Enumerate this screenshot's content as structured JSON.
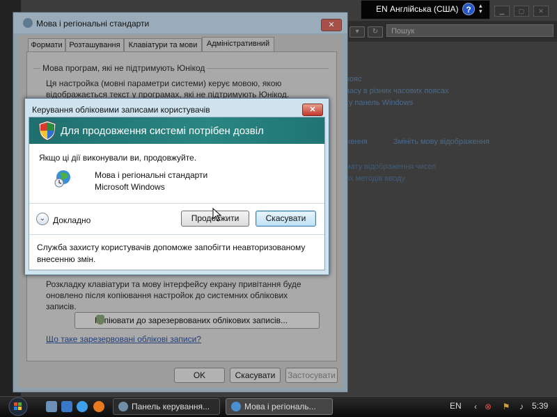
{
  "background": {
    "search_placeholder": "Пошук",
    "links": [
      "пояс",
      "часу в різних часових поясах",
      "ку панель Windows",
      "ження",
      "Змініть мову відображення",
      "мату відображення чисел",
      "их методів вводу"
    ]
  },
  "language_bar": {
    "text": "EN Англійська (США)",
    "help": "?"
  },
  "regional_dialog": {
    "title": "Мова і регіональні стандарти",
    "close": "✕",
    "tabs": [
      "Формати",
      "Розташування",
      "Клавіатури та мови",
      "Адміністративний"
    ],
    "unicode_group_label": "Мова програм, які не підтримують Юнікод",
    "unicode_text": "Ця настройка (мовні параметри системи) керує мовою, якою відображається текст у програмах, які не підтримують Юнікод.",
    "copy_text": "Розкладку клавіатури та мову інтерфейсу екрану привітання буде оновлено після копіювання настройок до системних облікових записів.",
    "copy_button": "Копіювати до зарезервованих облікових записів...",
    "reserved_link": "Що таке зарезервовані облікові записи?",
    "ok": "OK",
    "cancel": "Скасувати",
    "apply": "Застосувати"
  },
  "uac": {
    "title": "Керування обліковими записами користувачів",
    "close": "✕",
    "heading": "Для продовження системі потрібен дозвіл",
    "prompt": "Якщо ці дії виконували ви, продовжуйте.",
    "program_name": "Мова і регіональні стандарти",
    "publisher": "Microsoft Windows",
    "details": "Докладно",
    "continue": "Продовжити",
    "cancel": "Скасувати",
    "footer": "Служба захисту користувачів допоможе запобігти неавторизованому внесенню змін."
  },
  "taskbar": {
    "buttons": [
      "Панель керування...",
      "Мова і регіональ..."
    ],
    "tray_lang": "EN",
    "time": "5:39"
  },
  "colors": {
    "uac_banner": "#2a8682",
    "uac_frame": "#cfe4ef",
    "cancel_focus": "#bfe0f3"
  }
}
